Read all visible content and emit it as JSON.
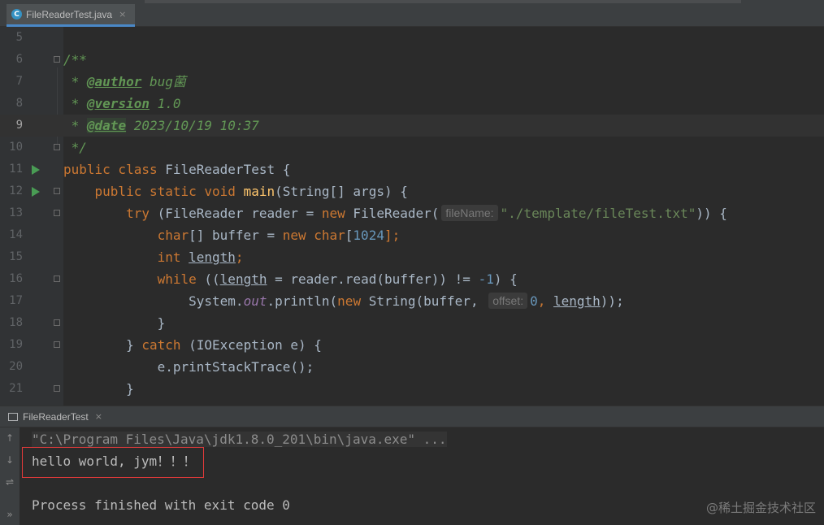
{
  "editor_tab": {
    "icon": "C",
    "label": "FileReaderTest.java",
    "close": "×"
  },
  "lines": [
    {
      "num": "5"
    },
    {
      "num": "6",
      "l1": "/**"
    },
    {
      "num": "7",
      "l1": " * ",
      "tag": "@author",
      "rest": " bug菌"
    },
    {
      "num": "8",
      "l1": " * ",
      "tag": "@version",
      "rest": " 1.0"
    },
    {
      "num": "9",
      "l1": " * ",
      "tag": "@date",
      "rest": " 2023/10/19 10:37"
    },
    {
      "num": "10",
      "l1": " */"
    },
    {
      "num": "11",
      "kw1": "public class ",
      "name": "FileReaderTest",
      "rest": " {"
    },
    {
      "num": "12",
      "kw1": "    public static void ",
      "fn": "main",
      "rest": "(String[] args) {"
    },
    {
      "num": "13",
      "kw1": "        try",
      "p1": " (FileReader reader = ",
      "kw2": "new",
      "p2": " FileReader(",
      "hint": "fileName:",
      "str": "\"./template/fileTest.txt\"",
      "p3": ")) {"
    },
    {
      "num": "14",
      "kw1": "            char",
      "p1": "[] buffer = ",
      "kw2": "new char",
      "p2": "[",
      "n1": "1024",
      "p3": "];"
    },
    {
      "num": "15",
      "kw1": "            int ",
      "v1": "length",
      "p1": ";"
    },
    {
      "num": "16",
      "kw1": "            while",
      "p1": " ((",
      "v1": "length",
      "p2": " = reader.read(buffer)) != ",
      "n1": "-1",
      "p3": ") {"
    },
    {
      "num": "17",
      "p0": "                System.",
      "fld": "out",
      "p1": ".println(",
      "kw1": "new",
      "p2": " String(buffer, ",
      "hint": "offset:",
      "n1": "0",
      "p3": ", ",
      "v1": "length",
      "p4": "));"
    },
    {
      "num": "18",
      "p0": "            }"
    },
    {
      "num": "19",
      "p0": "        } ",
      "kw1": "catch",
      "p1": " (IOException e) {"
    },
    {
      "num": "20",
      "p0": "            e.printStackTrace();"
    },
    {
      "num": "21",
      "p0": "        }"
    }
  ],
  "run_panel": {
    "tab_label": "FileReaderTest",
    "close": "×"
  },
  "console": {
    "command": "\"C:\\Program Files\\Java\\jdk1.8.0_201\\bin\\java.exe\" ...",
    "output": "hello world, jym！！！",
    "exit": "Process finished with exit code 0"
  },
  "side_icons": [
    "↑",
    "↓",
    "⇌",
    "»"
  ],
  "watermark": "@稀土掘金技术社区",
  "colors": {
    "keyword": "#cc7832",
    "comment": "#629755",
    "string": "#6a8759",
    "number": "#6897bb",
    "highlight": "#e23a3a"
  }
}
